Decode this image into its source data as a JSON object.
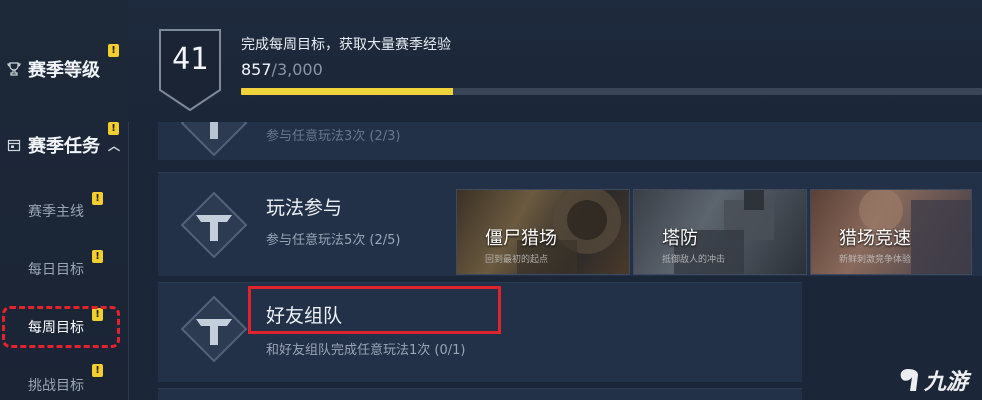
{
  "sidebar": {
    "season_level": "赛季等级",
    "season_tasks": "赛季任务",
    "sub_items": [
      "赛季主线",
      "每日目标",
      "每周目标",
      "挑战目标"
    ],
    "active_index": 2
  },
  "header": {
    "level": "41",
    "title": "完成每周目标，获取大量赛季经验",
    "xp_current": "857",
    "xp_separator": "/",
    "xp_max": "3,000",
    "progress_fraction": 0.2857
  },
  "tasks": [
    {
      "title": "",
      "desc": "参与任意玩法3次 (2/3)"
    },
    {
      "title": "玩法参与",
      "desc": "参与任意玩法5次 (2/5)"
    },
    {
      "title": "好友组队",
      "desc": "和好友组队完成任意玩法1次 (0/1)"
    }
  ],
  "modes": [
    {
      "name": "僵尸猎场",
      "sub": "回到最初的起点"
    },
    {
      "name": "塔防",
      "sub": "抵御敌人的冲击"
    },
    {
      "name": "猎场竞速",
      "sub": "新鲜刺激竞争体验"
    }
  ],
  "watermark": "九游",
  "colors": {
    "accent": "#f0d23a",
    "highlight": "#e0232c",
    "badge": "#f2cf2e"
  }
}
